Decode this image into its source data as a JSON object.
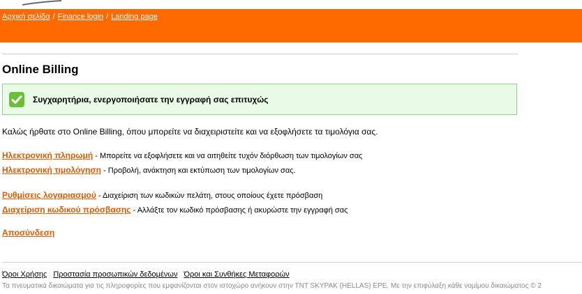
{
  "breadcrumb": {
    "items": [
      "Αρχική σελίδα",
      "Finance login",
      "Landing page"
    ],
    "separator": "/"
  },
  "page": {
    "title": "Online Billing"
  },
  "success": {
    "message": "Συγχαρητήρια, ενεργοποιήσατε την εγγραφή σας επιτυχώς",
    "icon": "check-icon"
  },
  "welcome": "Καλώς ήρθατε στο Online Billing, όπου μπορείτε να διαχειριστείτε και να εξοφλήσετε τα τιμολόγια σας.",
  "links": [
    {
      "label": "Ηλεκτρονική πληρωμή",
      "desc": " - Μπορείτε να εξοφλήσετε και να αιτηθείτε τυχόν διόρθωση των τιμολογίων σας"
    },
    {
      "label": "Ηλεκτρονική τιμολόγηση",
      "desc": " - Προβολή, ανάκτηση και εκτύπωση των τιμολογίων σας."
    },
    {
      "label": "Ρυθμίσεις λογαριασμού",
      "desc": " - Διαχείριση των κωδικών πελάτη, στους οποίους έχετε πρόσβαση"
    },
    {
      "label": "Διαχείριση κωδικού πρόσβασης",
      "desc": " - Αλλάξτε τον κωδικό πρόσβασης ή ακυρώστε την εγγραφή σας"
    },
    {
      "label": "Αποσύνδεση",
      "desc": ""
    }
  ],
  "footer": {
    "links": [
      "Όροι Χρήσης",
      "Προστασία προσωπικών δεδομένων",
      "Όροι και Συνθήκες Μεταφορών"
    ],
    "copyright": "Τα πνευματικά δικαιώματα για τις πληροφορίες που εμφανίζονται στον ιστοχώρο ανήκουν στην TNT SKYPAK (HELLAS) EPE. Με την επιφύλαξη κάθε νομίμου δικαιώματος © 2"
  },
  "colors": {
    "header_orange": "#ff6a00",
    "link_orange": "#e05a00",
    "success_bg": "#e9fbe6",
    "success_border": "#8fd48a",
    "check_green": "#6cbf3a"
  }
}
